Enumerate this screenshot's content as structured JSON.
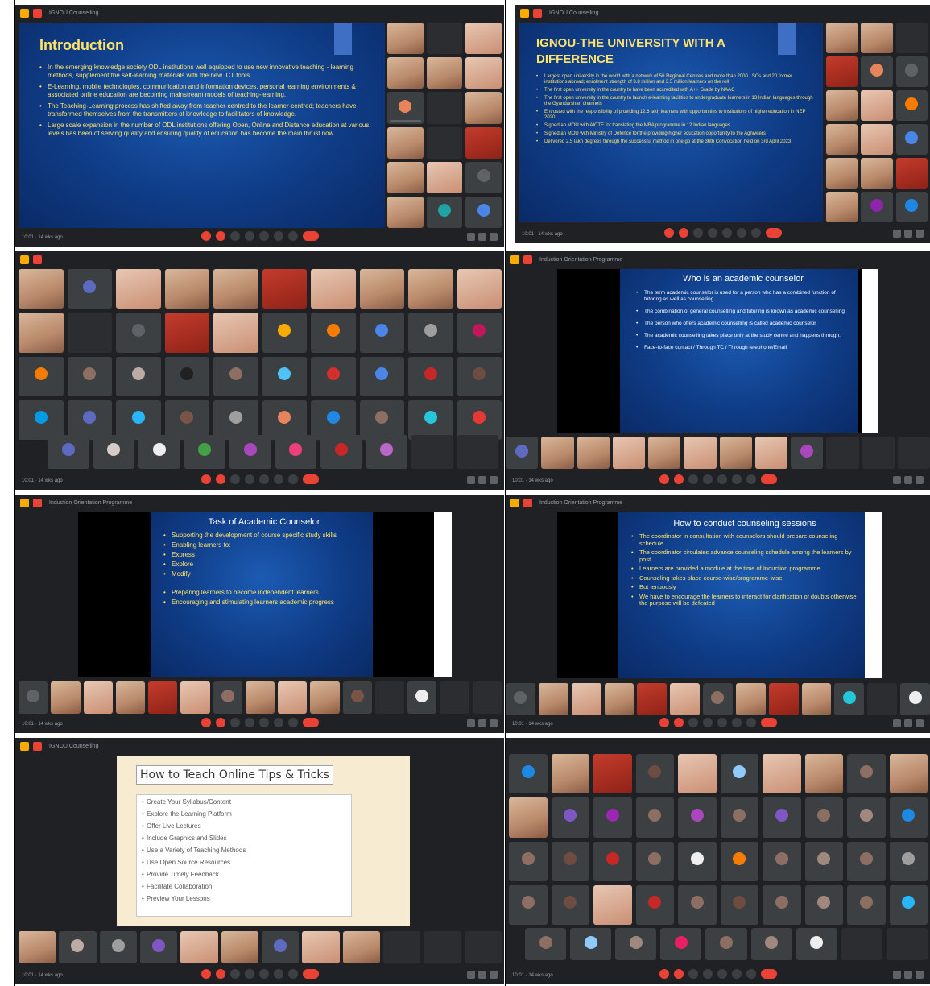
{
  "panels": {
    "p1": {
      "window_title": "IGNOU Counselling",
      "slide_title": "Introduction",
      "bullets": [
        "In the emerging knowledge society ODL institutions well equipped to use new innovative teaching - learning methods, supplement the self-learning materials with the new ICT tools.",
        "E-Learning, mobile technologies, communication and information devices, personal learning environments & associated online education are becoming mainstream models of teaching-learning.",
        "The Teaching-Learning process has shifted away from teacher-centred to the learner-centred; teachers have transformed themselves from the transmitters of knowledge to facilitators of knowledge.",
        "Large scale expansion in the number of ODL institutions offering Open, Online and Distance education at various levels has been of serving quality and ensuring quality of education has become the main thrust now."
      ]
    },
    "p2": {
      "window_title": "IGNOU Counselling",
      "slide_title": "IGNOU-THE UNIVERSITY WITH A DIFFERENCE",
      "bullets": [
        "Largest open university in the world with a network of 56 Regional Centres and more than 2000 LSCs and 20 former institutions abroad; enrolment strength of 3.8 million and 3.5 million learners on the roll",
        "The first open university in the country to have been accredited with A++ Grade by NAAC",
        "The first open university in the country to launch e-learning facilities to undergraduate learners in 13 Indian languages through the Gyandarshan channels",
        "Entrusted with the responsibility of providing 12.6 lakh learners with opportunities to institutions of higher education in NEP 2020",
        "Signed an MOU with AICTE for translating the MBA programme in 12 Indian languages",
        "Signed an MOU with Ministry of Defence for the providing higher education opportunity to the Agniveers",
        "Delivered 2.5 lakh degrees through the successful method in one go at the 36th Convocation held on 3rd April 2023"
      ]
    },
    "p4": {
      "window_title": "Induction Orientation Programme",
      "slide_title": "Who is an academic counselor",
      "bullets": [
        "The term academic counselor is used for a person who has a combined function of tutoring as well as counselling",
        "The combination of general counselling and tutoring is known as academic counselling",
        "The person who offers academic counselling is called academic counselor",
        "The academic counselling takes place only at the study centre and happens through:",
        "Face-to-face contact / Through TC / Through telephone/Email"
      ]
    },
    "p5": {
      "window_title": "Induction Orientation Programme",
      "slide_title": "Task of Academic Counselor",
      "bullets": [
        "Supporting the development of course specific study skills",
        "Enabling learners to:",
        "Express",
        "Explore",
        "Modify",
        "Preparing learners to become independent learners",
        "Encouraging and stimulating learners academic progress"
      ]
    },
    "p6": {
      "window_title": "Induction Orientation Programme",
      "slide_title": "How to conduct counseling sessions",
      "bullets": [
        "The coordinator in consultation with counselors should prepare counseling schedule",
        "The coordinator circulates advance counseling schedule among the learners by post",
        "Learners are provided a module at the time of Induction programme",
        "Counseling takes place course-wise/programme-wise",
        "But tenuously",
        "We have to encourage the learners to interact for clarification of doubts otherwise the purpose will be defeated"
      ]
    },
    "p7": {
      "window_title": "IGNOU Counselling",
      "slide_title": "How to Teach Online Tips & Tricks",
      "bullets": [
        "Create Your Syllabus/Content",
        "Explore the Learning Platform",
        "Offer Live Lectures",
        "Include Graphics and Slides",
        "Use a Variety of Teaching Methods",
        "Use Open Source Resources",
        "Provide Timely Feedback",
        "Facilitate Collaboration",
        "Preview Your Lessons"
      ]
    },
    "footer_time": "10:01 · 14 wks ago"
  }
}
